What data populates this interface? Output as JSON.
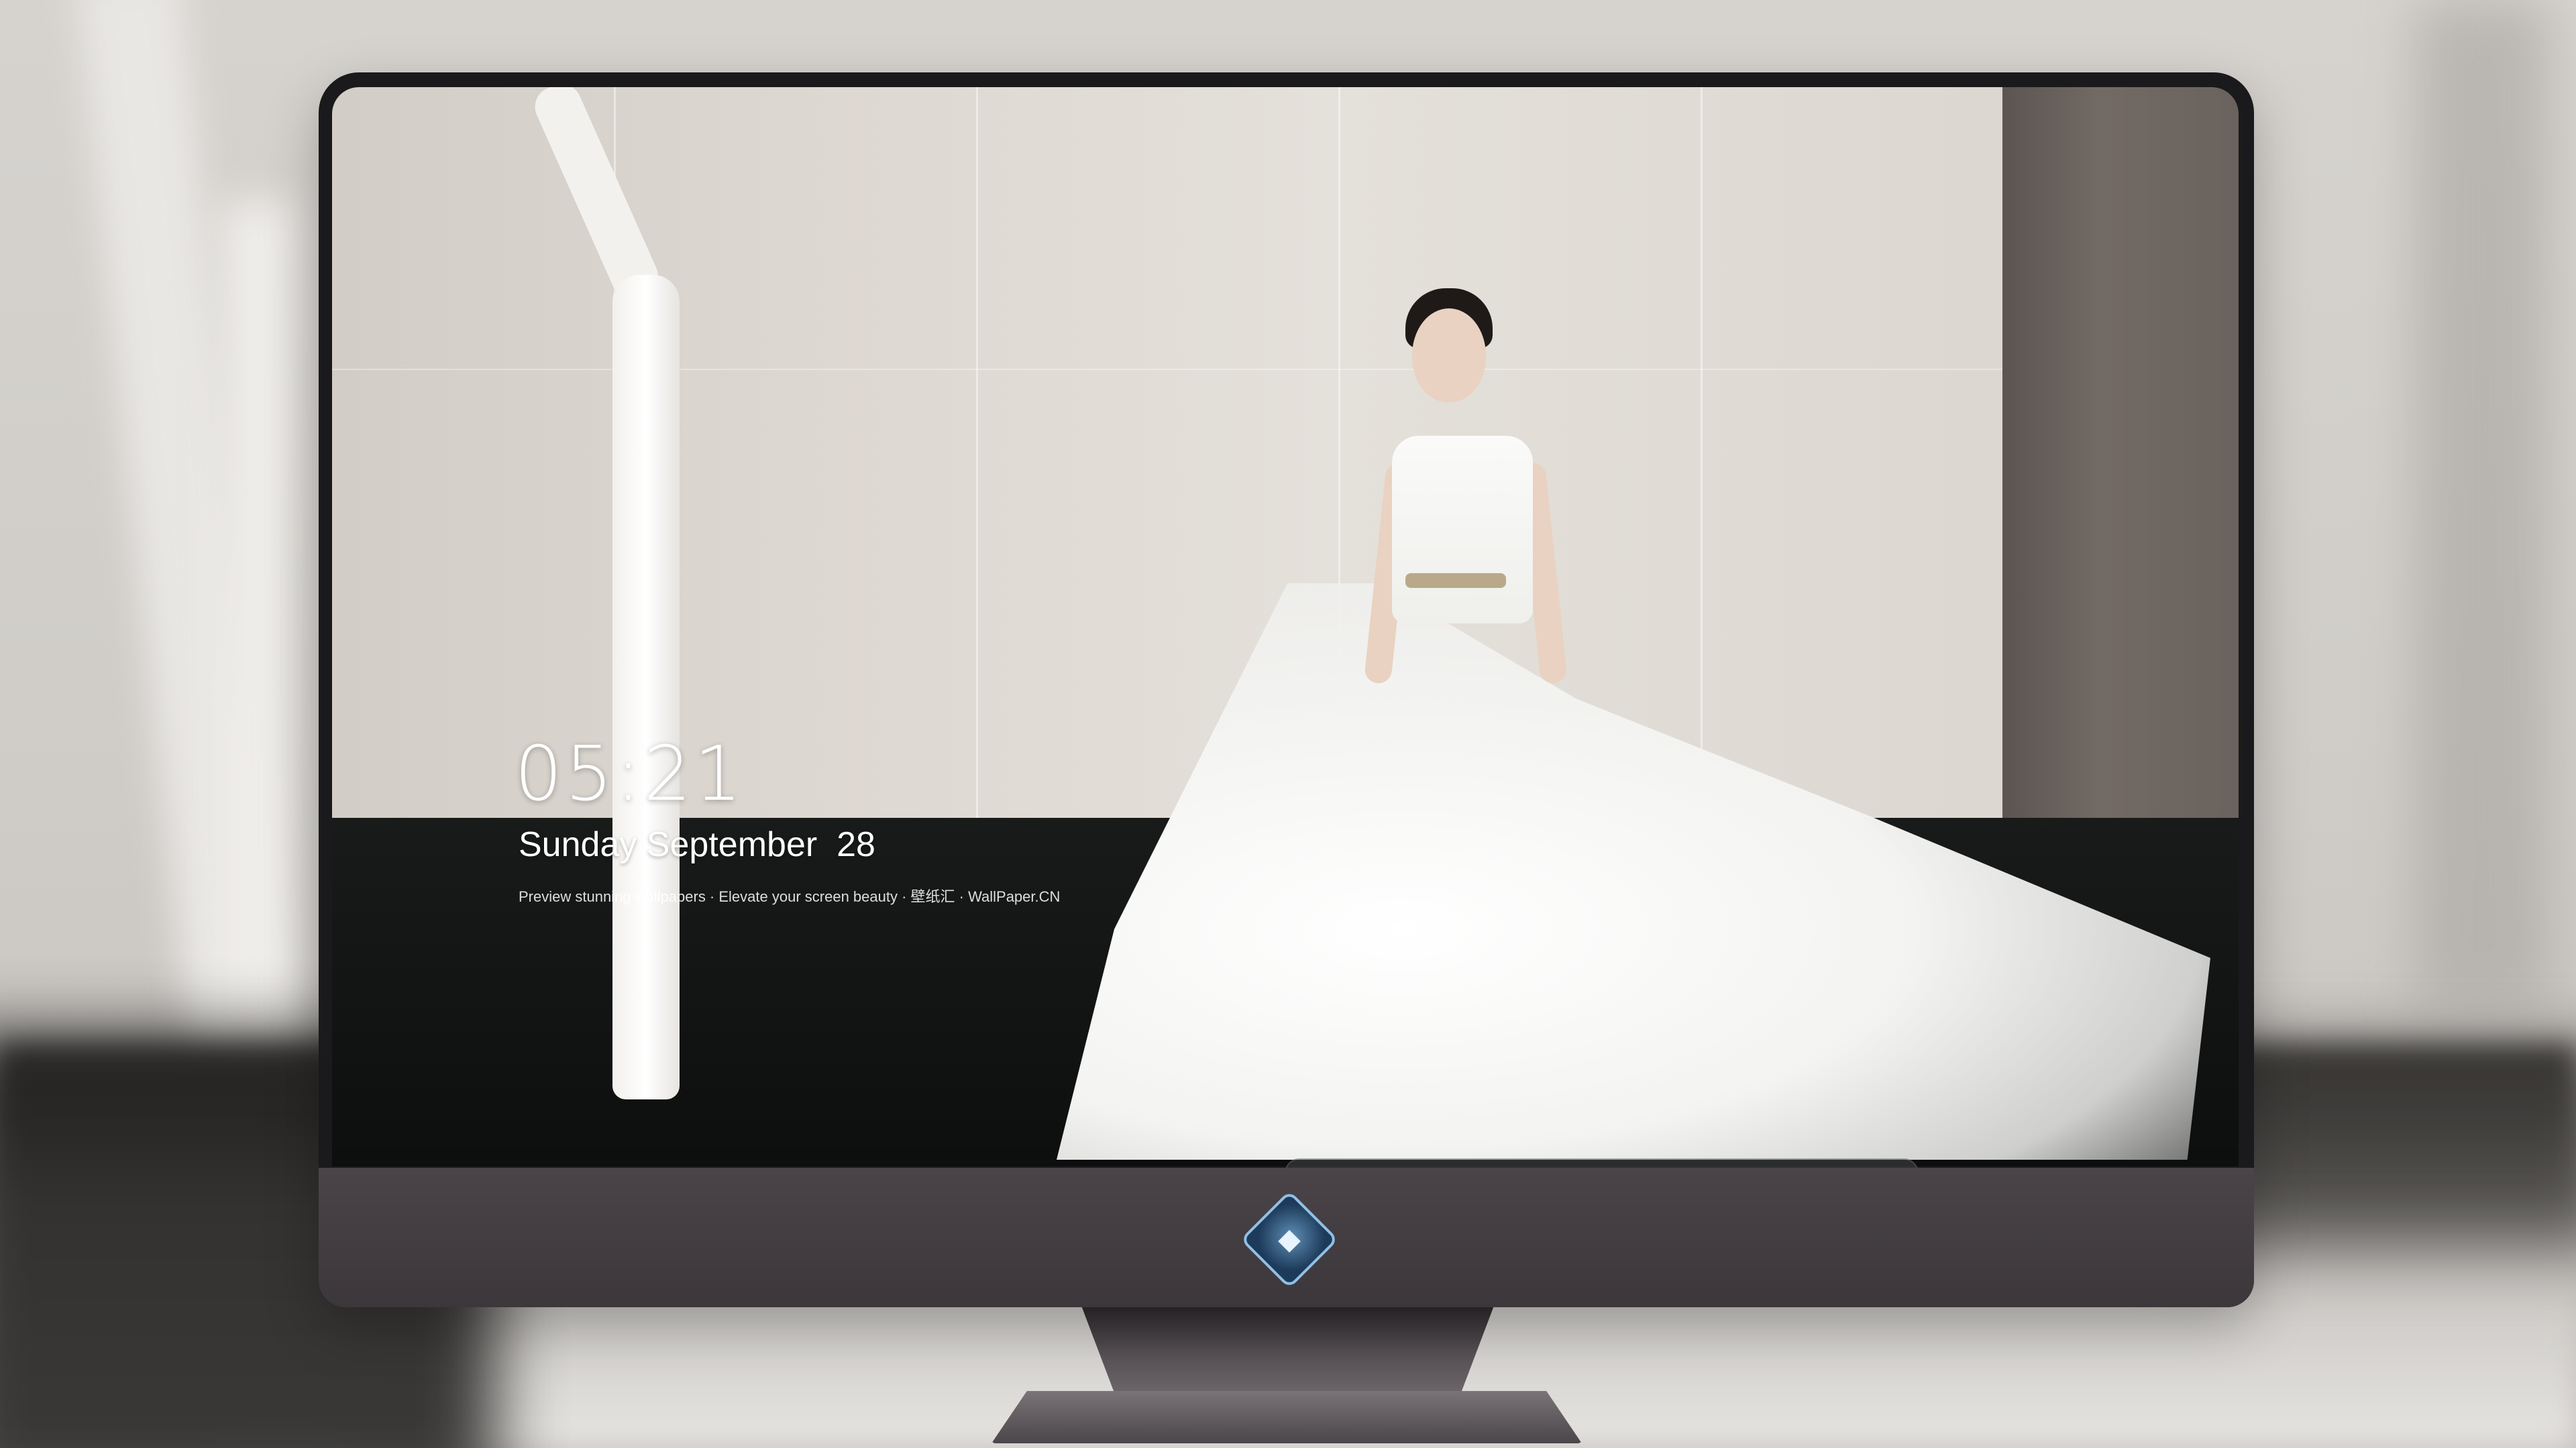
{
  "lockscreen": {
    "time": "05:21",
    "date": "Sunday September  28",
    "tagline": "Preview stunning wallpapers · Elevate your screen beauty · 壁纸汇 · WallPaper.CN"
  },
  "dock": {
    "apps": [
      {
        "name": "messages-icon",
        "glyph": "💬"
      },
      {
        "name": "weather-icon",
        "glyph": "☁"
      },
      {
        "name": "clock-icon",
        "glyph": "🕔"
      },
      {
        "name": "mail-icon",
        "glyph": "✉"
      },
      {
        "name": "video-icon",
        "glyph": "🎬"
      },
      {
        "name": "notes-icon",
        "glyph": "▤"
      },
      {
        "name": "photos-icon",
        "glyph": "▦"
      },
      {
        "name": "music-icon",
        "glyph": "♫"
      },
      {
        "name": "app-store-icon",
        "glyph": "Ⓐ"
      },
      {
        "name": "camera-icon",
        "glyph": "📷"
      }
    ]
  },
  "monitor": {
    "logo_glyph": "◆"
  },
  "colors": {
    "dock_background": "#464648",
    "chin": "#443f43",
    "screen_bezel": "#1a1a1c"
  }
}
